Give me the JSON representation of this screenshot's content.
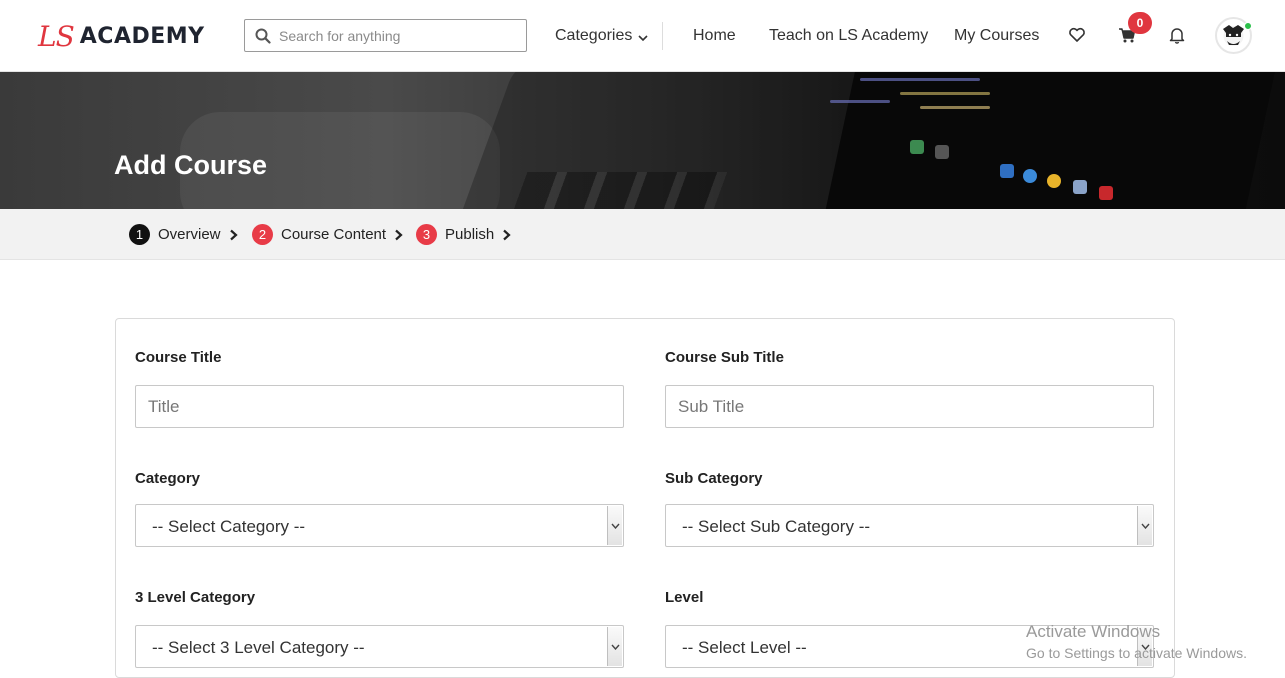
{
  "header": {
    "logo_ls": "LS",
    "logo_academy": "ACADEMY",
    "search_placeholder": "Search for anything",
    "categories_label": "Categories",
    "nav": [
      "Home",
      "Teach on LS Academy",
      "My Courses"
    ],
    "cart_count": "0",
    "icons": [
      "search-icon",
      "chevron-down-icon",
      "heart-icon",
      "cart-icon",
      "bell-icon",
      "avatar"
    ]
  },
  "banner": {
    "title": "Add Course"
  },
  "steps": [
    {
      "num": "1",
      "label": "Overview",
      "state": "active"
    },
    {
      "num": "2",
      "label": "Course Content",
      "state": "pending"
    },
    {
      "num": "3",
      "label": "Publish",
      "state": "pending"
    }
  ],
  "form": {
    "course_title_label": "Course Title",
    "course_title_placeholder": "Title",
    "course_subtitle_label": "Course Sub Title",
    "course_subtitle_placeholder": "Sub Title",
    "category_label": "Category",
    "category_value": "-- Select Category --",
    "subcategory_label": "Sub Category",
    "subcategory_value": "-- Select Sub Category --",
    "level3_label": "3 Level Category",
    "level3_value": "-- Select 3 Level Category --",
    "level_label": "Level",
    "level_value": "-- Select Level --"
  },
  "watermark": {
    "line1": "Activate Windows",
    "line2": "Go to Settings to activate Windows."
  },
  "colors": {
    "brand_red": "#e0363f",
    "step_active": "#111111",
    "step_pending": "#e83b47",
    "online_dot": "#2bc04a"
  }
}
